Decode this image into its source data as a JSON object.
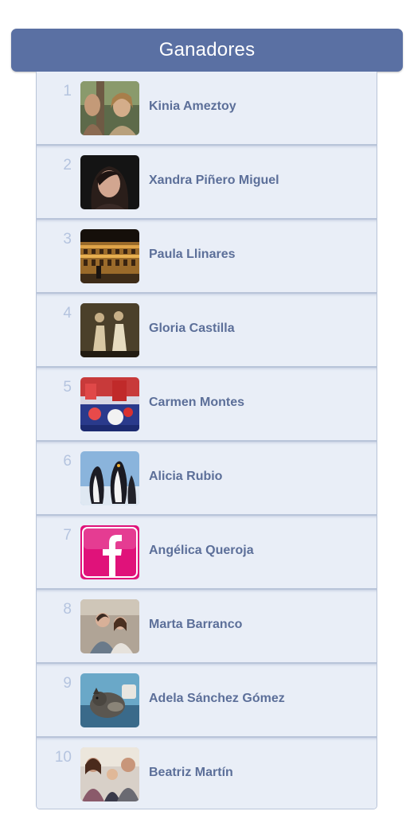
{
  "header": {
    "title": "Ganadores"
  },
  "winners": [
    {
      "rank": "1",
      "name": "Kinia Ameztoy",
      "avatar_icon": "photo-two-women-outdoors"
    },
    {
      "rank": "2",
      "name": "Xandra Piñero Miguel",
      "avatar_icon": "photo-woman-portrait-dark"
    },
    {
      "rank": "3",
      "name": "Paula Llinares",
      "avatar_icon": "photo-colosseum-night"
    },
    {
      "rank": "4",
      "name": "Gloria Castilla",
      "avatar_icon": "photo-sepia-group"
    },
    {
      "rank": "5",
      "name": "Carmen Montes",
      "avatar_icon": "photo-red-blue-party"
    },
    {
      "rank": "6",
      "name": "Alicia Rubio",
      "avatar_icon": "photo-penguins"
    },
    {
      "rank": "7",
      "name": "Angélica Queroja",
      "avatar_icon": "facebook-logo-icon"
    },
    {
      "rank": "8",
      "name": "Marta Barranco",
      "avatar_icon": "photo-couple"
    },
    {
      "rank": "9",
      "name": "Adela Sánchez Gómez",
      "avatar_icon": "photo-pet-dog"
    },
    {
      "rank": "10",
      "name": "Beatriz Martín",
      "avatar_icon": "photo-family-group"
    }
  ],
  "colors": {
    "header_bg": "#5a70a3",
    "row_bg": "#e9eef7",
    "name_text": "#5c6f99",
    "rank_text": "#b5c4df",
    "facebook_pink": "#e0127a"
  }
}
